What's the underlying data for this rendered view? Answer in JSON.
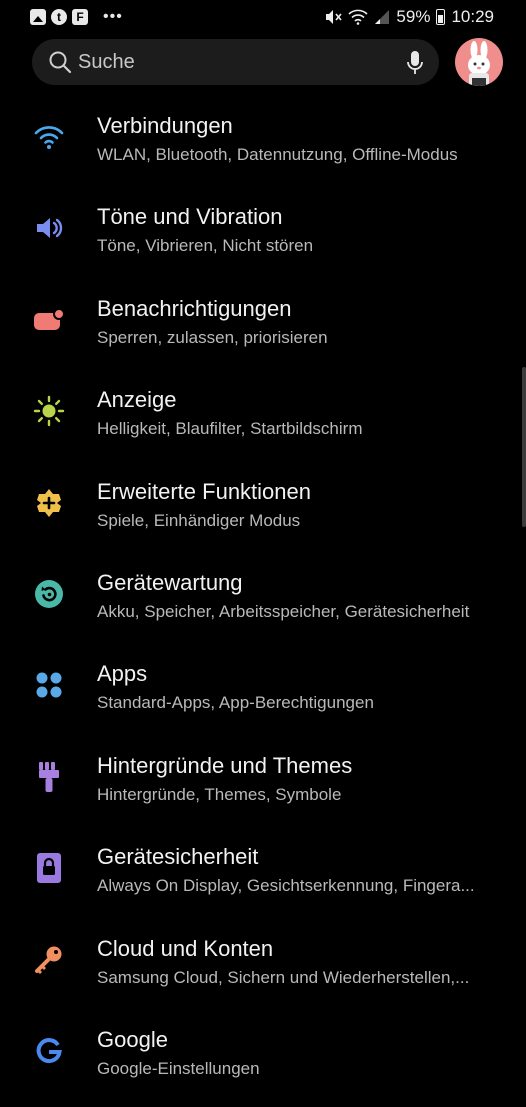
{
  "status_bar": {
    "left_icons": [
      "image-icon",
      "tumblr-icon",
      "flipboard-icon"
    ],
    "more": "•••",
    "battery": "59%",
    "time": "10:29"
  },
  "search": {
    "placeholder": "Suche"
  },
  "settings": [
    {
      "title": "Verbindungen",
      "subtitle": "WLAN, Bluetooth, Datennutzung, Offline-Modus",
      "icon": "wifi-icon",
      "color": "#4aa8f0"
    },
    {
      "title": "Töne und Vibration",
      "subtitle": "Töne, Vibrieren, Nicht stören",
      "icon": "speaker-icon",
      "color": "#7a8ef0"
    },
    {
      "title": "Benachrichtigungen",
      "subtitle": "Sperren, zulassen, priorisieren",
      "icon": "notification-icon",
      "color": "#f07a74"
    },
    {
      "title": "Anzeige",
      "subtitle": "Helligkeit, Blaufilter, Startbildschirm",
      "icon": "sun-icon",
      "color": "#b8d44a"
    },
    {
      "title": "Erweiterte Funktionen",
      "subtitle": "Spiele, Einhändiger Modus",
      "icon": "puzzle-plus-icon",
      "color": "#f0c04a"
    },
    {
      "title": "Gerätewartung",
      "subtitle": "Akku, Speicher, Arbeitsspeicher, Gerätesicherheit",
      "icon": "maintenance-icon",
      "color": "#4ab8a8"
    },
    {
      "title": "Apps",
      "subtitle": "Standard-Apps, App-Berechtigungen",
      "icon": "apps-icon",
      "color": "#5aa8e8"
    },
    {
      "title": "Hintergründe und Themes",
      "subtitle": "Hintergründe, Themes, Symbole",
      "icon": "brush-icon",
      "color": "#a880e0"
    },
    {
      "title": "Gerätesicherheit",
      "subtitle": "Always On Display, Gesichtserkennung, Fingera...",
      "icon": "lock-icon",
      "color": "#9a7ae0"
    },
    {
      "title": "Cloud und Konten",
      "subtitle": "Samsung Cloud, Sichern und Wiederherstellen,...",
      "icon": "key-icon",
      "color": "#f09060"
    },
    {
      "title": "Google",
      "subtitle": "Google-Einstellungen",
      "icon": "google-icon",
      "color": "#4a8af0"
    }
  ]
}
